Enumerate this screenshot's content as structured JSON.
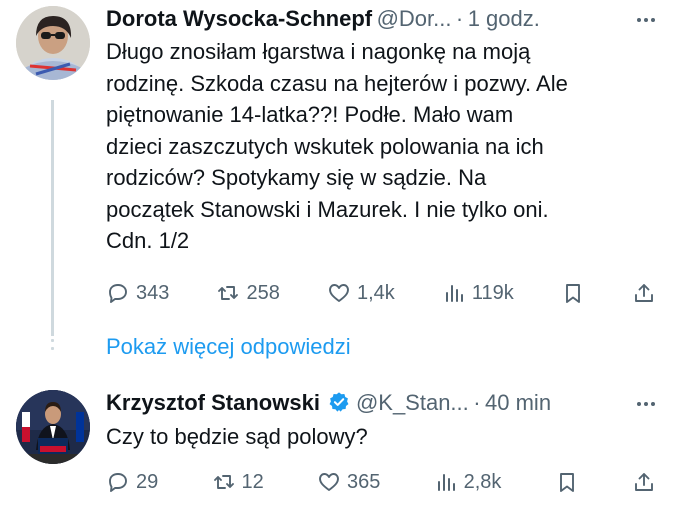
{
  "tweet1": {
    "author_name": "Dorota Wysocka-Schnepf",
    "handle": "@Dor...",
    "separator": "·",
    "time": "1 godz.",
    "text": "Długo znosiłam łgarstwa i nagonkę na moją\nrodzinę. Szkoda czasu na hejterów i pozwy. Ale\npiętnowanie 14-latka??! Podłe. Mało wam\ndzieci zaszczutych wskutek polowania na ich\nrodziców? Spotykamy się w sądzie. Na\npoczątek Stanowski i Mazurek. I nie tylko oni.\nCdn. 1/2",
    "replies": "343",
    "reposts": "258",
    "likes": "1,4k",
    "views": "119k"
  },
  "show_more": "Pokaż więcej odpowiedzi",
  "tweet2": {
    "author_name": "Krzysztof Stanowski",
    "handle": "@K_Stan...",
    "separator": "·",
    "time": "40 min",
    "text": "Czy to będzie sąd polowy?",
    "replies": "29",
    "reposts": "12",
    "likes": "365",
    "views": "2,8k"
  },
  "colors": {
    "accent": "#1d9bf0",
    "muted": "#536471",
    "text": "#0f1419",
    "thread": "#cfd9de"
  },
  "icons": [
    "reply-icon",
    "repost-icon",
    "like-icon",
    "views-icon",
    "bookmark-icon",
    "share-icon",
    "more-icon",
    "verified-badge-icon"
  ]
}
